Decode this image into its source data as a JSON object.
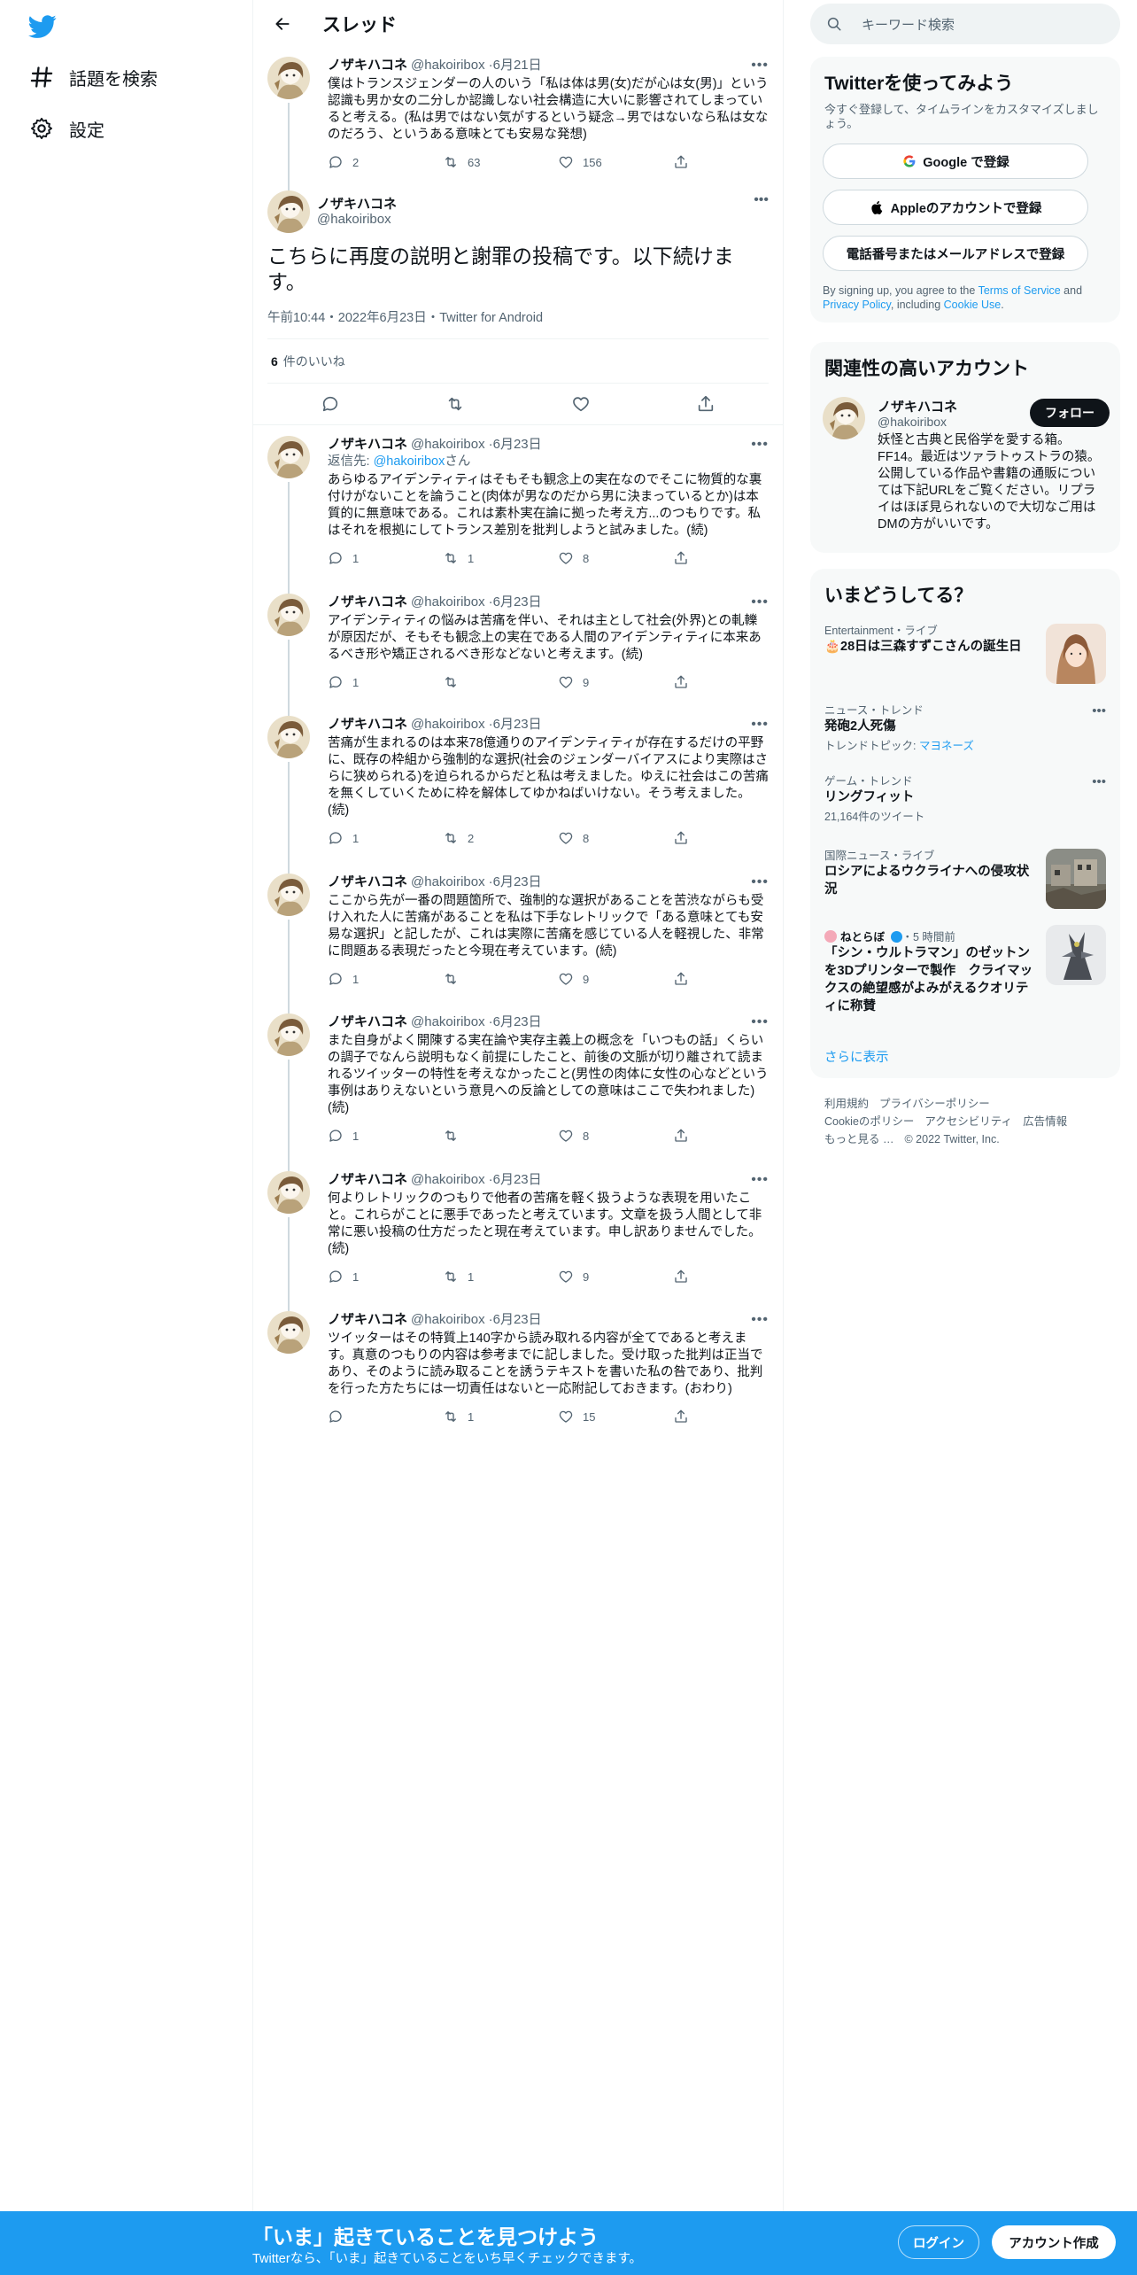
{
  "nav": {
    "logo_icon": "twitter-bird-icon",
    "explore_label": "話題を検索",
    "settings_label": "設定"
  },
  "header": {
    "title": "スレッド"
  },
  "prev_tweet": {
    "name": "ノザキハコネ",
    "handle": "@hakoiribox",
    "date": "6月21日",
    "text": "僕はトランスジェンダーの人のいう「私は体は男(女)だが心は女(男)」という認識も男か女の二分しか認識しない社会構造に大いに影響されてしまっていると考える。(私は男ではない気がするという疑念→男ではないなら私は女なのだろう、というある意味とても安易な発想)",
    "replies": "2",
    "retweets": "63",
    "likes": "156"
  },
  "main_tweet": {
    "name": "ノザキハコネ",
    "handle": "@hakoiribox",
    "text": "こちらに再度の説明と謝罪の投稿です。以下続けます。",
    "meta": "午前10:44・2022年6月23日・Twitter for Android",
    "like_count": "6",
    "like_label": "件のいいね"
  },
  "replies": [
    {
      "name": "ノザキハコネ",
      "handle": "@hakoiribox",
      "date": "6月23日",
      "reply_prefix": "返信先: ",
      "reply_mention": "@hakoiribox",
      "reply_suffix": "さん",
      "text": "あらゆるアイデンティティはそもそも観念上の実在なのでそこに物質的な裏付けがないことを論うこと(肉体が男なのだから男に決まっているとか)は本質的に無意味である。これは素朴実在論に拠った考え方...のつもりです。私はそれを根拠にしてトランス差別を批判しようと試みました。(続)",
      "replies": "1",
      "retweets": "1",
      "likes": "8"
    },
    {
      "name": "ノザキハコネ",
      "handle": "@hakoiribox",
      "date": "6月23日",
      "text": "アイデンティティの悩みは苦痛を伴い、それは主として社会(外界)との軋轢が原因だが、そもそも観念上の実在である人間のアイデンティティに本来あるべき形や矯正されるべき形などないと考えます。(続)",
      "replies": "1",
      "retweets": "",
      "likes": "9"
    },
    {
      "name": "ノザキハコネ",
      "handle": "@hakoiribox",
      "date": "6月23日",
      "text": "苦痛が生まれるのは本来78億通りのアイデンティティが存在するだけの平野に、既存の枠組から強制的な選択(社会のジェンダーバイアスにより実際はさらに狭められる)を迫られるからだと私は考えました。ゆえに社会はこの苦痛を無くしていくために枠を解体してゆかねばいけない。そう考えました。(続)",
      "replies": "1",
      "retweets": "2",
      "likes": "8"
    },
    {
      "name": "ノザキハコネ",
      "handle": "@hakoiribox",
      "date": "6月23日",
      "text": "ここから先が一番の問題箇所で、強制的な選択があることを苦渋ながらも受け入れた人に苦痛があることを私は下手なレトリックで「ある意味とても安易な選択」と記したが、これは実際に苦痛を感じている人を軽視した、非常に問題ある表現だったと今現在考えています。(続)",
      "replies": "1",
      "retweets": "",
      "likes": "9"
    },
    {
      "name": "ノザキハコネ",
      "handle": "@hakoiribox",
      "date": "6月23日",
      "text": "また自身がよく開陳する実在論や実存主義上の概念を「いつもの話」くらいの調子でなんら説明もなく前提にしたこと、前後の文脈が切り離されて読まれるツイッターの特性を考えなかったこと(男性の肉体に女性の心などという事例はありえないという意見への反論としての意味はここで失われました)(続)",
      "replies": "1",
      "retweets": "",
      "likes": "8"
    },
    {
      "name": "ノザキハコネ",
      "handle": "@hakoiribox",
      "date": "6月23日",
      "text": "何よりレトリックのつもりで他者の苦痛を軽く扱うような表現を用いたこと。これらがことに悪手であったと考えています。文章を扱う人間として非常に悪い投稿の仕方だったと現在考えています。申し訳ありませんでした。(続)",
      "replies": "1",
      "retweets": "1",
      "likes": "9"
    },
    {
      "name": "ノザキハコネ",
      "handle": "@hakoiribox",
      "date": "6月23日",
      "text": "ツイッターはその特質上140字から読み取れる内容が全てであると考えます。真意のつもりの内容は参考までに記しました。受け取った批判は正当であり、そのように読み取ることを誘うテキストを書いた私の咎であり、批判を行った方たちには一切責任はないと一応附記しておきます。(おわり)",
      "replies": "",
      "retweets": "1",
      "likes": "15"
    }
  ],
  "search": {
    "placeholder": "キーワード検索"
  },
  "signup_panel": {
    "title": "Twitterを使ってみよう",
    "subtitle": "今すぐ登録して、タイムラインをカスタマイズしましょう。",
    "google": "Google で登録",
    "apple": "Appleのアカウントで登録",
    "phone": "電話番号またはメールアドレスで登録",
    "legal_1": "By signing up, you agree to the ",
    "legal_tos": "Terms of Service",
    "legal_2": " and ",
    "legal_privacy": "Privacy Policy",
    "legal_3": ", including ",
    "legal_cookie": "Cookie Use",
    "legal_4": "."
  },
  "related_panel": {
    "title": "関連性の高いアカウント",
    "name": "ノザキハコネ",
    "handle": "@hakoiribox",
    "follow": "フォロー",
    "bio": "妖怪と古典と民俗学を愛する箱。FF14。最近はツァラトゥストラの猿。公開している作品や書籍の通販については下記URLをご覧ください。リプライはほぼ見られないので大切なご用はDMの方がいいです。"
  },
  "trends_panel": {
    "title": "いまどうしてる？",
    "items": [
      {
        "context": "Entertainment・ライブ",
        "title": "🎂28日は三森すずこさんの誕生日"
      },
      {
        "context": "ニュース・トレンド",
        "title": "発砲2人死傷",
        "sub_prefix": "トレンドトピック: ",
        "sub_link": "マヨネーズ"
      },
      {
        "context": "ゲーム・トレンド",
        "title": "リングフィット",
        "sub": "21,164件のツイート"
      },
      {
        "context": "国際ニュース・ライブ",
        "title": "ロシアによるウクライナへの侵攻状況"
      },
      {
        "context_name": "ねとらぼ",
        "context_time": "・5 時間前",
        "title": "「シン・ウルトラマン」のゼットンを3Dプリンターで製作　クライマックスの絶望感がよみがえるクオリティに称賛"
      }
    ],
    "show_more": "さらに表示"
  },
  "footer": {
    "terms": "利用規約",
    "privacy": "プライバシーポリシー",
    "cookies": "Cookieのポリシー",
    "accessibility": "アクセシビリティ",
    "ads": "広告情報",
    "more": "もっと見る …",
    "copyright": "© 2022 Twitter, Inc."
  },
  "banner": {
    "title": "「いま」起きていることを見つけよう",
    "subtitle": "Twitterなら、「いま」起きていることをいち早くチェックできます。",
    "login": "ログイン",
    "signup": "アカウント作成"
  },
  "colors": {
    "accent": "#1d9bf0",
    "text": "#0f1419",
    "muted": "#536471"
  }
}
